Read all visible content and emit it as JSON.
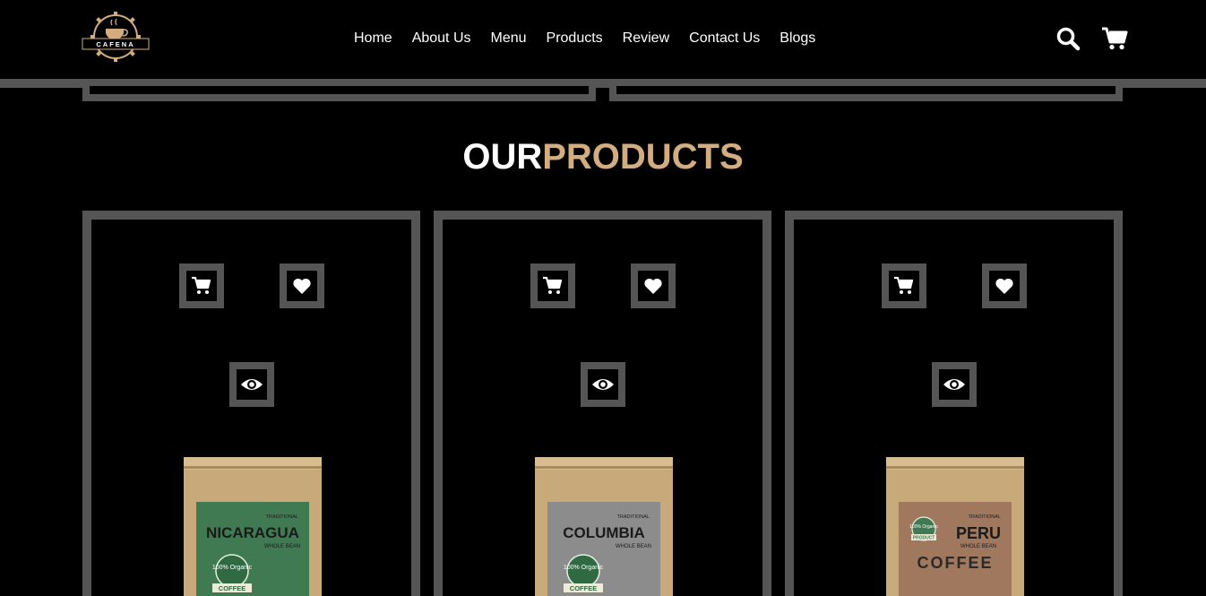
{
  "brand": {
    "logo_text": "CAFENA"
  },
  "nav": {
    "items": [
      {
        "label": "Home"
      },
      {
        "label": "About Us"
      },
      {
        "label": "Menu"
      },
      {
        "label": "Products"
      },
      {
        "label": "Review"
      },
      {
        "label": "Contact Us"
      },
      {
        "label": "Blogs"
      }
    ]
  },
  "header_icons": [
    "search-icon",
    "cart-icon"
  ],
  "section": {
    "title_part1": "OUR",
    "title_part2": "PRODUCTS"
  },
  "products": [
    {
      "bag_name": "NICARAGUA",
      "bag_sub": "WHOLE BEAN",
      "bag_tag": "TRADITIONAL",
      "badge": "100% Organic",
      "ribbon": "COFFEE",
      "label_color": "#3f7a52"
    },
    {
      "bag_name": "COLUMBIA",
      "bag_sub": "WHOLE BEAN",
      "bag_tag": "TRADITIONAL",
      "badge": "100% Organic",
      "ribbon": "COFFEE",
      "label_color": "#8c8c8c"
    },
    {
      "bag_name": "PERU",
      "bag_sub": "WHOLE BEAN",
      "bag_tag": "TRADITIONAL",
      "badge": "100% Organic",
      "ribbon": "PRODUCT",
      "label_title2": "COFFEE",
      "label_color": "#a0785e"
    }
  ],
  "colors": {
    "accent": "#d3ad7f",
    "border": "#555555",
    "background": "#000000"
  }
}
